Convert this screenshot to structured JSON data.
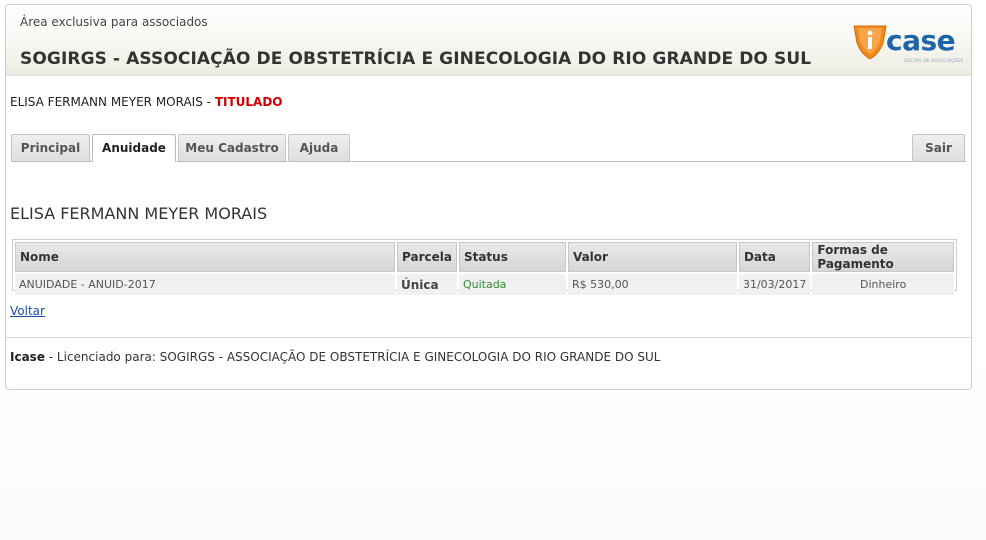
{
  "header": {
    "subtitle": "Área exclusiva para associados",
    "title": "SOGIRGS - ASSOCIAÇÃO DE OBSTETRÍCIA E GINECOLOGIA DO RIO GRANDE DO SUL",
    "logo_text": "case",
    "logo_tagline": "GESTÃO DE ASSOCIAÇÕES"
  },
  "user": {
    "name": "ELISA FERMANN MEYER MORAIS",
    "separator": " - ",
    "role": "TITULADO"
  },
  "tabs": [
    {
      "label": "Principal"
    },
    {
      "label": "Anuidade"
    },
    {
      "label": "Meu Cadastro"
    },
    {
      "label": "Ajuda"
    }
  ],
  "logout_label": "Sair",
  "section_name": "ELISA FERMANN MEYER MORAIS",
  "table": {
    "headers": [
      "Nome",
      "Parcela",
      "Status",
      "Valor",
      "Data",
      "Formas de Pagamento"
    ],
    "rows": [
      [
        "ANUIDADE - ANUID-2017",
        "Única",
        "Quitada",
        "R$ 530,00",
        "31/03/2017",
        "Dinheiro"
      ]
    ]
  },
  "back_label": "Voltar",
  "footer": {
    "brand": "Icase",
    "text": " - Licenciado para: SOGIRGS - ASSOCIAÇÃO DE OBSTETRÍCIA E GINECOLOGIA DO RIO GRANDE DO SUL"
  },
  "colors": {
    "role": "#d40000",
    "status_paid": "#2f8a2f",
    "logo_blue": "#1e64a8",
    "logo_orange": "#f08a1c"
  }
}
